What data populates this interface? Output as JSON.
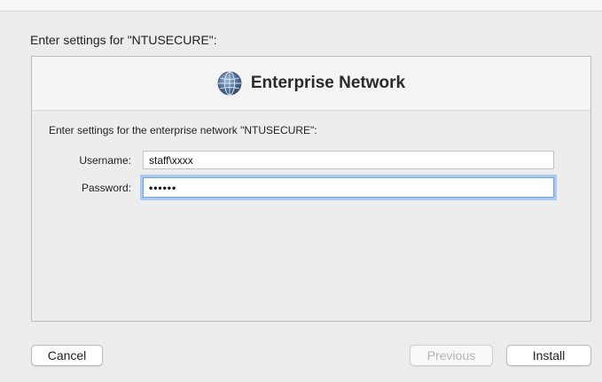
{
  "dialog": {
    "title": "Enter settings for \"NTUSECURE\":"
  },
  "panel": {
    "heading": "Enterprise Network",
    "icon": "network-globe-icon",
    "intro": "Enter settings for the enterprise network \"NTUSECURE\":"
  },
  "form": {
    "username_label": "Username:",
    "username_value": "staff\\xxxx",
    "password_label": "Password:",
    "password_value": "••••••"
  },
  "buttons": {
    "cancel": "Cancel",
    "previous": "Previous",
    "install": "Install"
  },
  "colors": {
    "focus_ring": "#a9c9f0",
    "window_bg": "#ececec"
  }
}
